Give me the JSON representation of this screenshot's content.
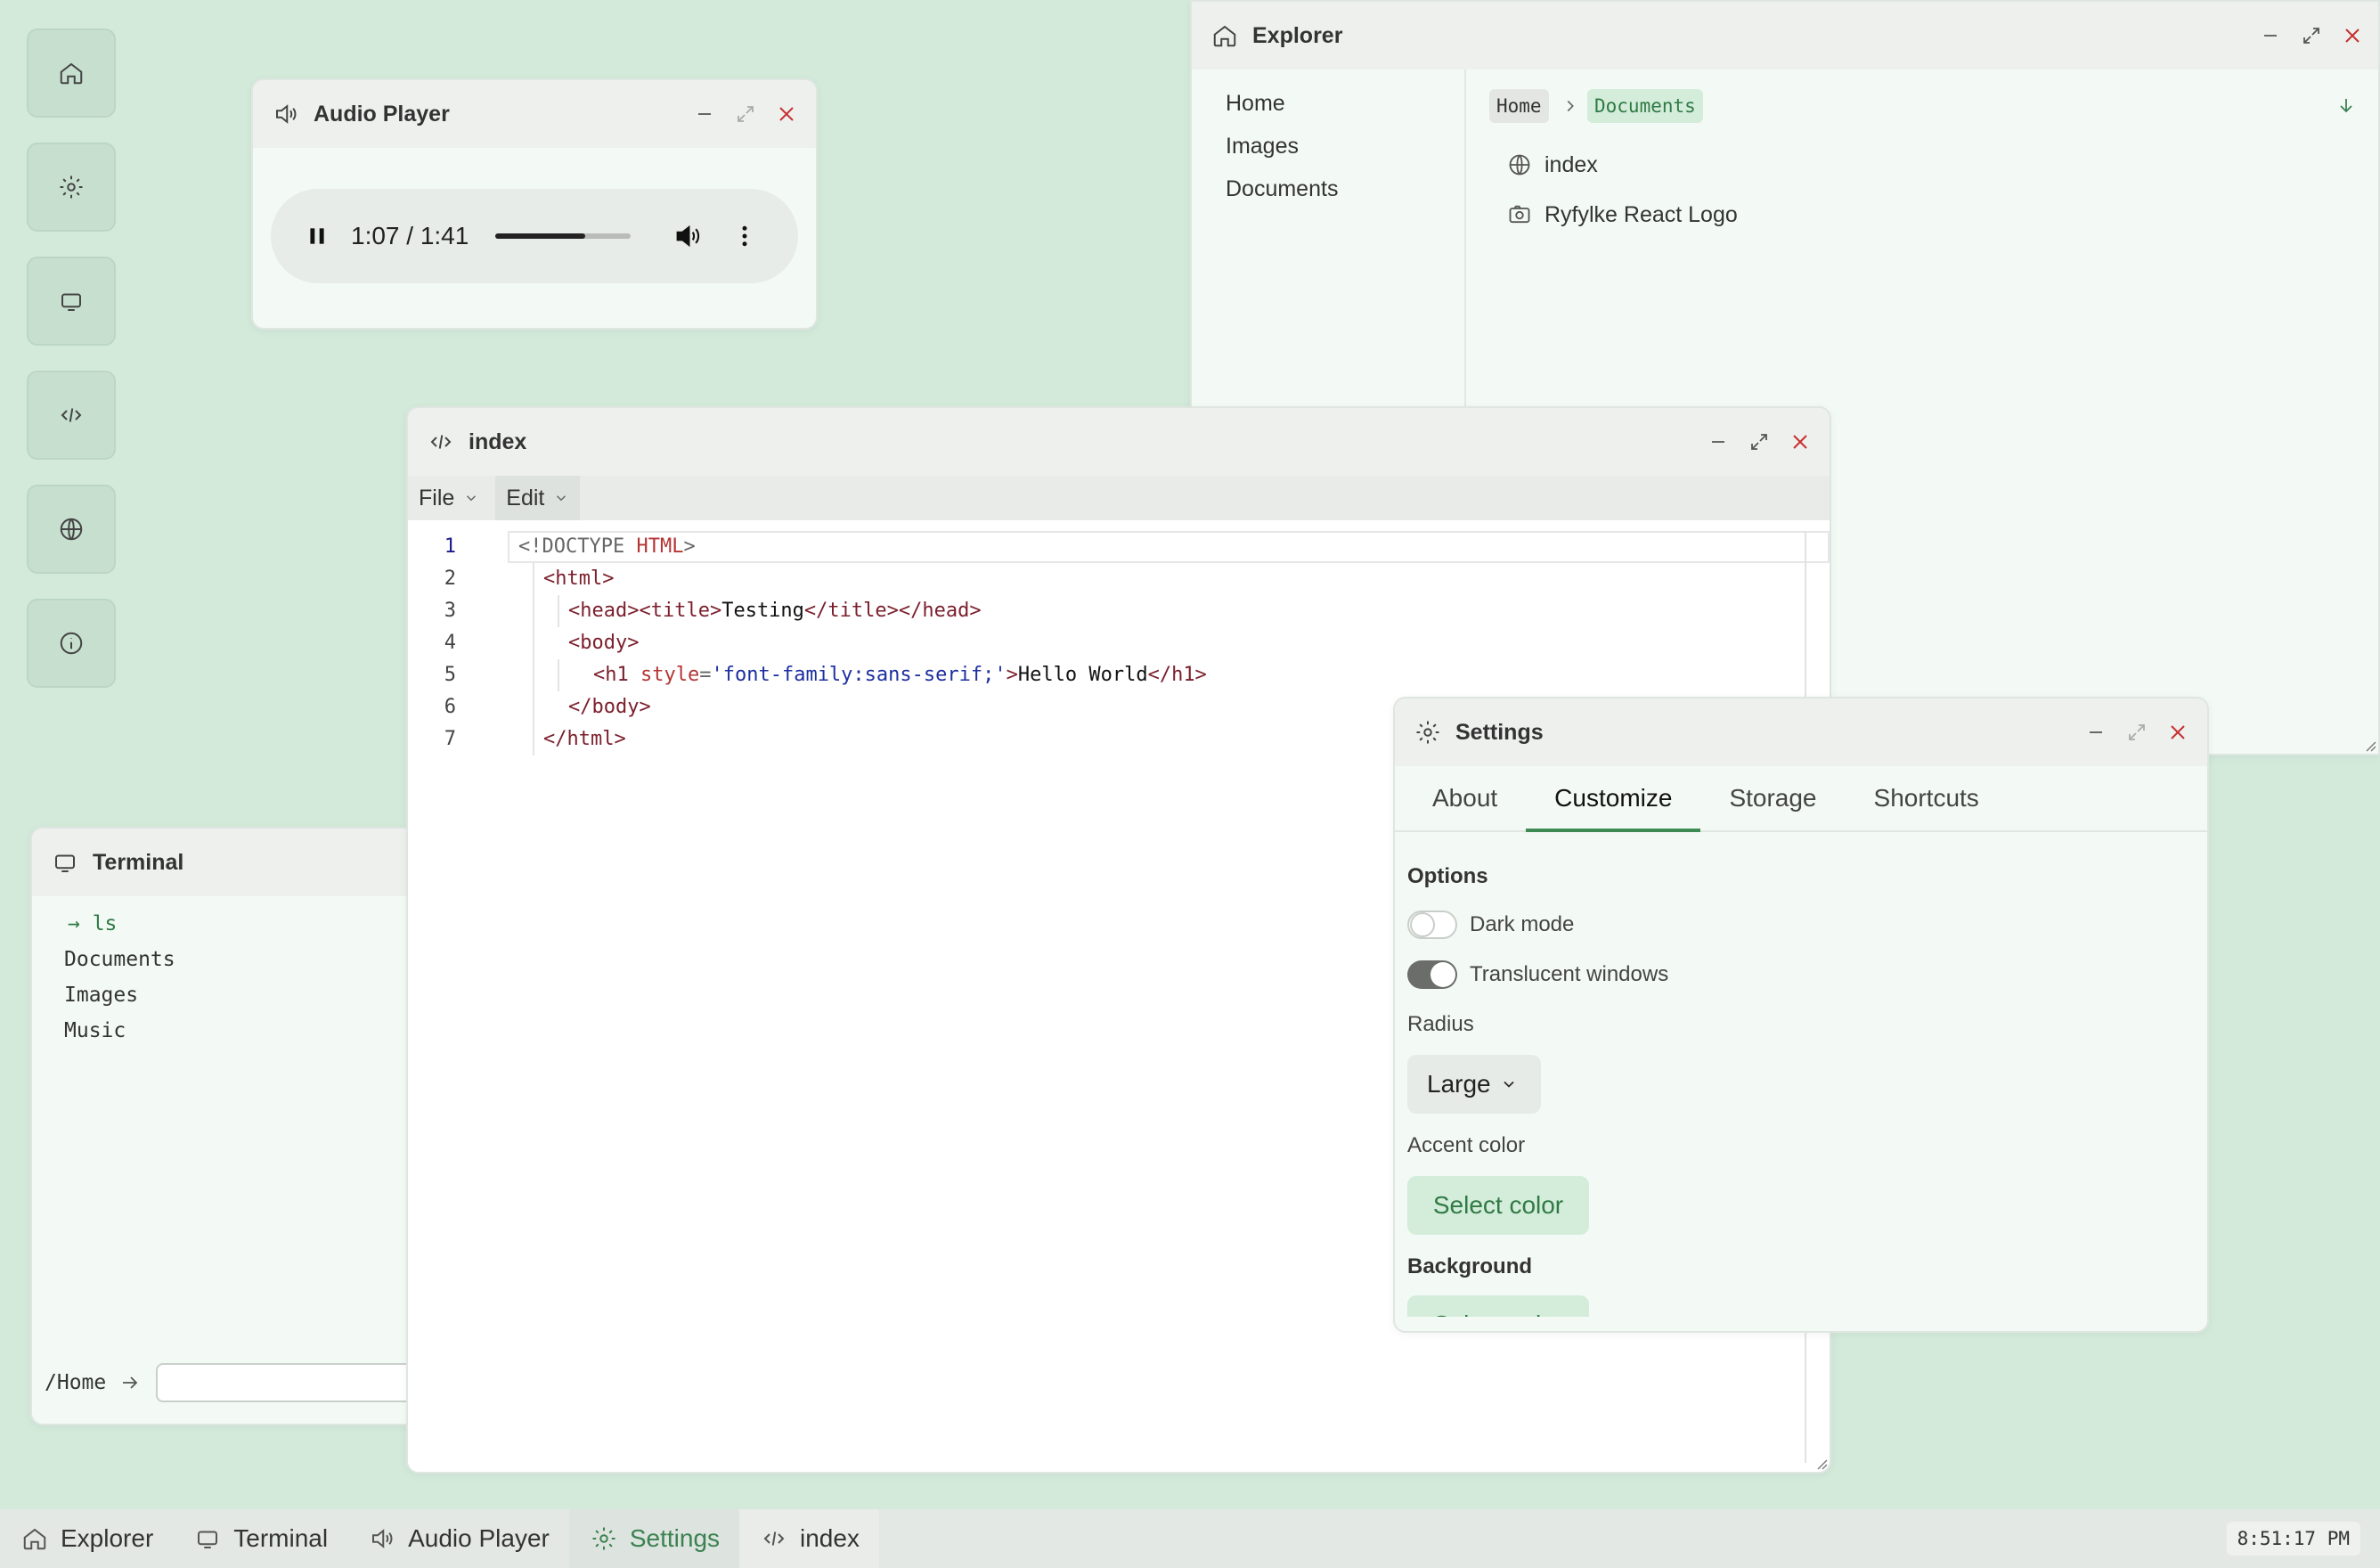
{
  "colors": {
    "accent": "#3d8a52",
    "desktop_bg": "#d3eadb",
    "close_red": "#c62f2f"
  },
  "desktop_icons": [
    "home-icon",
    "gear-icon",
    "monitor-icon",
    "code-icon",
    "globe-icon",
    "info-icon"
  ],
  "audio_player": {
    "title": "Audio Player",
    "time": "1:07 / 1:41",
    "progress_percent": 66,
    "icons": [
      "speaker-icon",
      "pause-icon",
      "volume-icon",
      "more-vertical-icon"
    ]
  },
  "explorer": {
    "title": "Explorer",
    "sidebar": [
      "Home",
      "Images",
      "Documents"
    ],
    "breadcrumb": [
      "Home",
      "Documents"
    ],
    "items": [
      {
        "label": "index",
        "icon": "globe-icon"
      },
      {
        "label": "Ryfylke React Logo",
        "icon": "image-icon"
      }
    ]
  },
  "editor": {
    "title": "index",
    "menu": [
      "File",
      "Edit"
    ],
    "line_numbers": [
      "1",
      "2",
      "3",
      "4",
      "5",
      "6",
      "7"
    ],
    "lines": [
      "<!DOCTYPE HTML>",
      "<html>",
      "<head><title>Testing</title></head>",
      "<body>",
      "<h1 style='font-family:sans-serif;'>Hello World</h1>",
      "</body>",
      "</html>"
    ],
    "tokens": {
      "doctype": "<!DOCTYPE",
      "doctype_name": "HTML",
      "gt": ">",
      "html_open": "<html>",
      "head_open": "<head>",
      "title_open": "<title>",
      "title_text": "Testing",
      "title_close": "</title>",
      "head_close": "</head>",
      "body_open": "<body>",
      "h1_open": "<h1",
      "style_attr": "style",
      "eq": "=",
      "style_value": "'font-family:sans-serif;'",
      "h1_text": "Hello World",
      "h1_close": "</h1>",
      "body_close": "</body>",
      "html_close": "</html>"
    }
  },
  "settings": {
    "title": "Settings",
    "tabs": [
      "About",
      "Customize",
      "Storage",
      "Shortcuts"
    ],
    "active_tab": "Customize",
    "options_heading": "Options",
    "dark_mode_label": "Dark mode",
    "dark_mode_on": false,
    "translucent_label": "Translucent windows",
    "translucent_on": true,
    "radius_label": "Radius",
    "radius_value": "Large",
    "accent_label": "Accent color",
    "select_color_label": "Select color",
    "background_heading": "Background",
    "background_button_label": "Select color"
  },
  "terminal": {
    "title": "Terminal",
    "command": "ls",
    "output": [
      "Documents",
      "Images",
      "Music"
    ],
    "prompt_path": "/Home",
    "input_value": ""
  },
  "taskbar": {
    "items": [
      {
        "label": "Explorer",
        "icon": "home-icon"
      },
      {
        "label": "Terminal",
        "icon": "monitor-icon"
      },
      {
        "label": "Audio Player",
        "icon": "speaker-icon"
      },
      {
        "label": "Settings",
        "icon": "gear-icon"
      },
      {
        "label": "index",
        "icon": "code-icon"
      }
    ],
    "active": "Settings",
    "clock": "8:51:17 PM"
  }
}
